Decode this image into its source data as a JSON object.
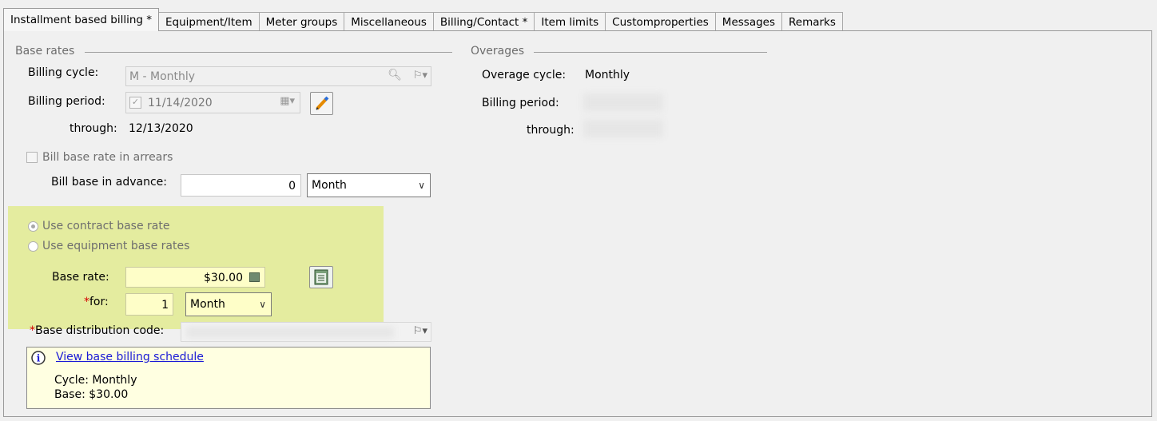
{
  "tabs": [
    {
      "label": "Installment based billing *",
      "active": true
    },
    {
      "label": "Equipment/Item"
    },
    {
      "label": "Meter groups"
    },
    {
      "label": "Miscellaneous"
    },
    {
      "label": "Billing/Contact *"
    },
    {
      "label": "Item limits"
    },
    {
      "label": "Customproperties"
    },
    {
      "label": "Messages"
    },
    {
      "label": "Remarks"
    }
  ],
  "base_rates": {
    "title": "Base rates",
    "billing_cycle_label": "Billing cycle:",
    "billing_cycle_value": "M - Monthly",
    "billing_period_label": "Billing period:",
    "billing_period_value": "11/14/2020",
    "through_label": "through:",
    "through_value": "12/13/2020",
    "arrears_label": "Bill base rate in arrears",
    "advance_label": "Bill base in advance:",
    "advance_value": "0",
    "advance_unit": "Month",
    "radio_contract_label": "Use contract base rate",
    "radio_equipment_label": "Use equipment base rates",
    "base_rate_label": "Base rate:",
    "base_rate_value": "$30.00",
    "for_required": "*",
    "for_label": "for:",
    "for_value": "1",
    "for_unit": "Month",
    "distribution_required": "*",
    "distribution_label": "Base distribution code:"
  },
  "overages": {
    "title": "Overages",
    "cycle_label": "Overage cycle:",
    "cycle_value": "Monthly",
    "billing_period_label": "Billing period:",
    "through_label": "through:"
  },
  "info": {
    "link": "View base billing schedule",
    "cycle": "Cycle: Monthly",
    "base": "Base: $30.00"
  },
  "colors": {
    "highlight": "#e3eb9a",
    "info_bg": "#ffffe1",
    "link": "#1a1ad6",
    "required": "#d40000"
  }
}
